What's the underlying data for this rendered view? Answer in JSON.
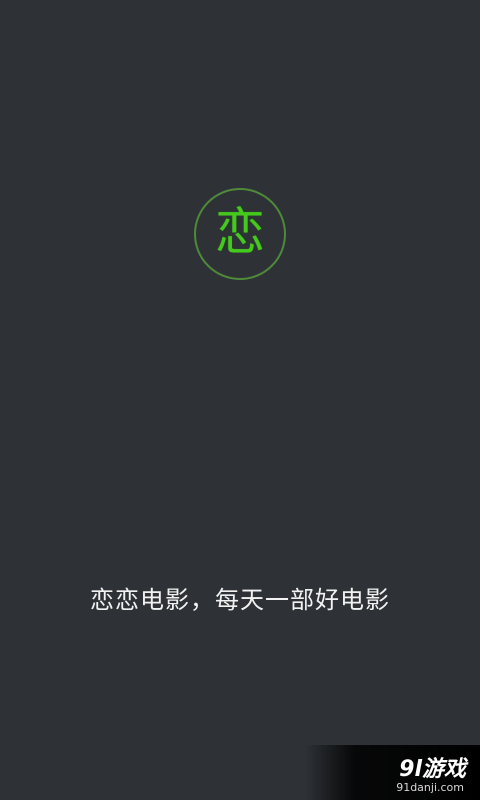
{
  "splash": {
    "logo_char": "恋",
    "tagline": "恋恋电影，每天一部好电影"
  },
  "watermark": {
    "title": "9l游戏",
    "url": "91danji.com"
  },
  "colors": {
    "background": "#2e3236",
    "logo_green": "#45c91f",
    "logo_ring": "#4f8a3a",
    "tagline_text": "#f2f2f2"
  }
}
